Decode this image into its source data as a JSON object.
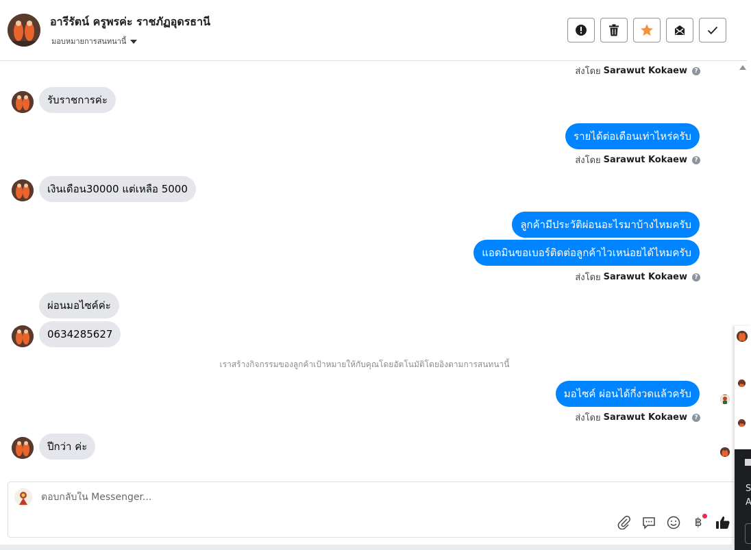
{
  "header": {
    "contact_name": "อารีรัตน์ ครูพรค่ะ ราชภัฏอุดรธานี",
    "assign_label": "มอบหมายการสนทนานี้",
    "actions": [
      {
        "name": "report-spam-button",
        "icon": "exclamation-circle-icon"
      },
      {
        "name": "delete-button",
        "icon": "trash-icon"
      },
      {
        "name": "star-button",
        "icon": "star-icon",
        "color": "#f7923a"
      },
      {
        "name": "mark-unread-button",
        "icon": "envelope-icon"
      },
      {
        "name": "mark-done-button",
        "icon": "checkmark-icon"
      }
    ]
  },
  "sent_by_prefix": "ส่งโดย",
  "sent_by_name": "Sarawut Kokaew",
  "messages": [
    {
      "id": "m1",
      "dir": "in",
      "text": "รับราชการค่ะ"
    },
    {
      "id": "m2",
      "dir": "out",
      "text": "รายได้ต่อเดือนเท่าไหร่ครับ"
    },
    {
      "id": "m3",
      "dir": "in",
      "text": "เงินเดือน30000  แต่เหลือ 5000"
    },
    {
      "id": "m4",
      "dir": "out",
      "text": "ลูกค้ามีประวัติผ่อนอะไรมาบ้างไหมครับ"
    },
    {
      "id": "m5",
      "dir": "out",
      "text": "แอดมินขอเบอร์ติดต่อลูกค้าไวเหน่อยได้ไหมครับ"
    },
    {
      "id": "m6",
      "dir": "in",
      "text": "ผ่อนมอไซค์ค่ะ"
    },
    {
      "id": "m7",
      "dir": "in",
      "text": "0634285627"
    },
    {
      "id": "m8",
      "dir": "out",
      "text": "มอไซค์ ผ่อนได้กี่งวดแล้วครับ"
    },
    {
      "id": "m9",
      "dir": "in",
      "text": "ปีกว่า ค่ะ"
    }
  ],
  "system_note": "เราสร้างกิจกรรมของลูกค้าเป้าหมายให้กับคุณโดยอัตโนมัติโดยอิงตามการสนทนานี้",
  "composer": {
    "placeholder": "ตอบกลับใน Messenger...",
    "tools": [
      "attachment-icon",
      "saved-reply-icon",
      "emoji-icon",
      "baht-payment-icon",
      "thumbs-up-icon"
    ]
  },
  "side_panel": {
    "text_line1": "S",
    "text_line2": "A"
  },
  "colors": {
    "outgoing_bubble": "#0084ff",
    "incoming_bubble": "#e4e6eb",
    "star": "#f7923a"
  }
}
